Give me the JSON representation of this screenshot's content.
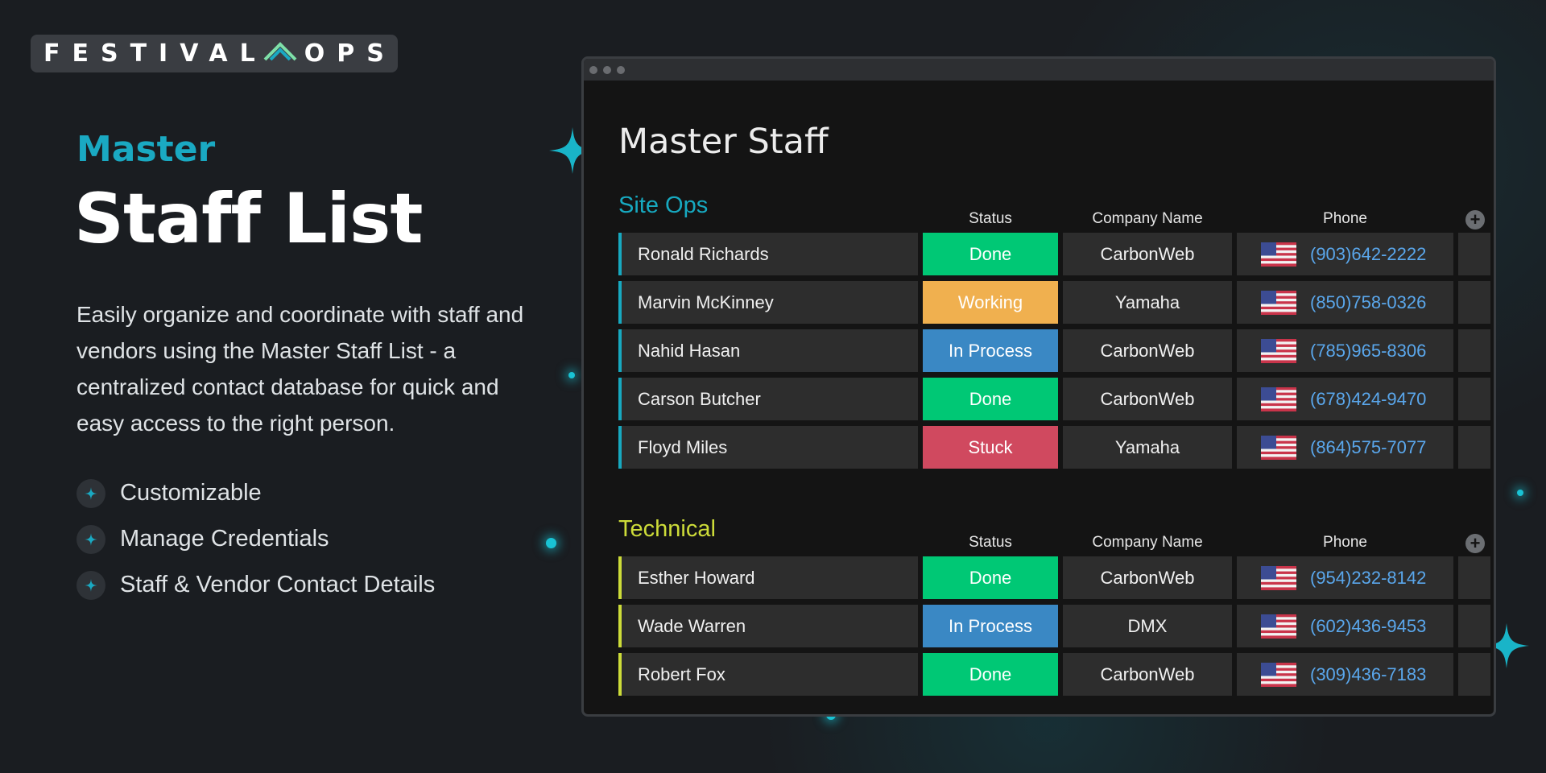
{
  "brand": {
    "logo_left": "FESTIVAL",
    "logo_right": "OPS",
    "accent": "#1aa9c2"
  },
  "hero": {
    "kicker": "Master",
    "title": "Staff List",
    "description": "Easily organize and coordinate with staff and vendors using the Master Staff List - a centralized contact database for quick and easy access to the right person.",
    "features": [
      "Customizable",
      "Manage Credentials",
      "Staff & Vendor Contact Details"
    ]
  },
  "board": {
    "title": "Master Staff",
    "columns": {
      "status": "Status",
      "company": "Company Name",
      "phone": "Phone"
    },
    "status_colors": {
      "Done": "#00c875",
      "Working": "#f0b04f",
      "In Process": "#3a88c4",
      "Stuck": "#d0495f"
    },
    "groups": [
      {
        "title": "Site Ops",
        "color": "#17a9c0",
        "rows": [
          {
            "name": "Ronald Richards",
            "status": "Done",
            "company": "CarbonWeb",
            "phone": "(903)642-2222"
          },
          {
            "name": "Marvin McKinney",
            "status": "Working",
            "company": "Yamaha",
            "phone": "(850)758-0326"
          },
          {
            "name": "Nahid Hasan",
            "status": "In Process",
            "company": "CarbonWeb",
            "phone": "(785)965-8306"
          },
          {
            "name": "Carson Butcher",
            "status": "Done",
            "company": "CarbonWeb",
            "phone": "(678)424-9470"
          },
          {
            "name": "Floyd Miles",
            "status": "Stuck",
            "company": "Yamaha",
            "phone": "(864)575-7077"
          }
        ]
      },
      {
        "title": "Technical",
        "color": "#cddc39",
        "rows": [
          {
            "name": "Esther Howard",
            "status": "Done",
            "company": "CarbonWeb",
            "phone": "(954)232-8142"
          },
          {
            "name": "Wade Warren",
            "status": "In Process",
            "company": "DMX",
            "phone": "(602)436-9453"
          },
          {
            "name": "Robert Fox",
            "status": "Done",
            "company": "CarbonWeb",
            "phone": "(309)436-7183"
          }
        ]
      }
    ]
  }
}
